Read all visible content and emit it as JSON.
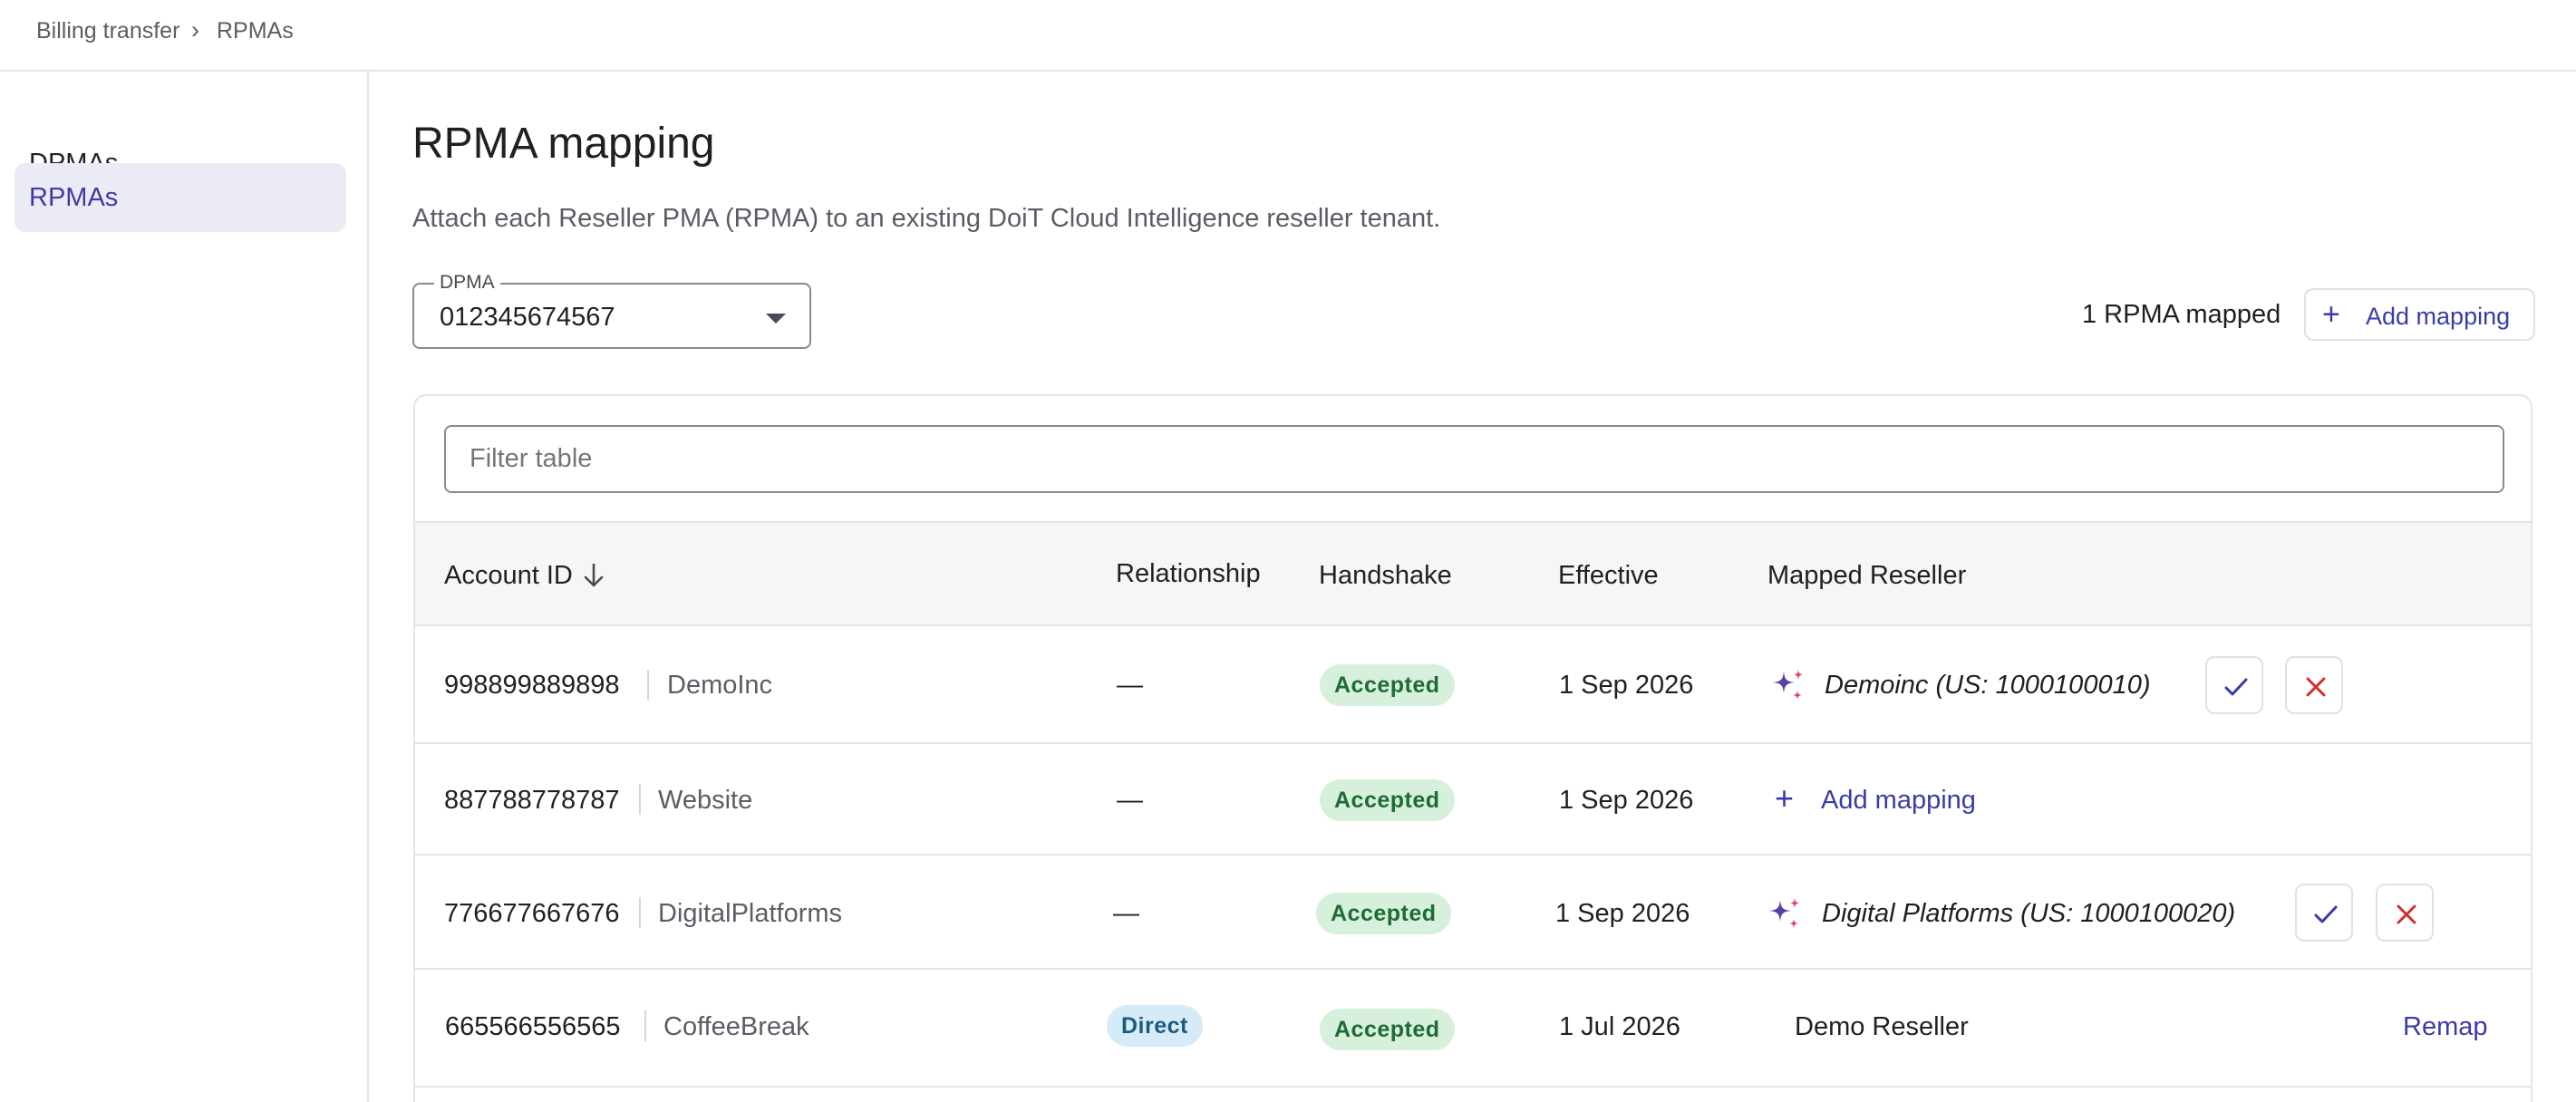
{
  "breadcrumb": {
    "parent": "Billing transfer",
    "separator": "›",
    "current": "RPMAs"
  },
  "sidebar": {
    "items": [
      {
        "label": "DPMAs"
      },
      {
        "label": "RPMAs"
      }
    ]
  },
  "main": {
    "title": "RPMA mapping",
    "subtitle": "Attach each Reseller PMA (RPMA) to an existing DoiT Cloud Intelligence reseller tenant.",
    "dpma_select": {
      "label": "DPMA",
      "value": "012345674567"
    },
    "mapped_count": "1 RPMA mapped",
    "add_mapping_label": "Add mapping"
  },
  "table": {
    "filter_placeholder": "Filter table",
    "columns": {
      "account_id": "Account ID",
      "relationship": "Relationship",
      "handshake": "Handshake",
      "effective": "Effective",
      "mapped_reseller": "Mapped Reseller"
    },
    "rows": [
      {
        "account_id": "998899889898",
        "name": "DemoInc",
        "relationship": "—",
        "handshake": "Accepted",
        "effective": "1 Sep 2026",
        "reseller": "Demoinc (US: 1000100010)"
      },
      {
        "account_id": "887788778787",
        "name": "Website",
        "relationship": "—",
        "handshake": "Accepted",
        "effective": "1 Sep 2026",
        "action_label": "Add mapping"
      },
      {
        "account_id": "776677667676",
        "name": "DigitalPlatforms",
        "relationship": "—",
        "handshake": "Accepted",
        "effective": "1 Sep 2026",
        "reseller": "Digital Platforms (US: 1000100020)"
      },
      {
        "account_id": "665566556565",
        "name": "CoffeeBreak",
        "relationship": "Direct",
        "handshake": "Accepted",
        "effective": "1 Jul 2026",
        "reseller_plain": "Demo Reseller",
        "action_label": "Remap"
      }
    ]
  },
  "colors": {
    "accent": "#3b3ba8",
    "accepted_bg": "#d6f0dc",
    "accepted_fg": "#1e6b35",
    "direct_bg": "#d6ebf8",
    "direct_fg": "#1d5a80",
    "danger": "#d32f2f"
  },
  "icons": [
    "chevron-right-icon",
    "caret-down-icon",
    "plus-icon",
    "arrow-down-icon",
    "sparkle-icon",
    "check-icon",
    "close-icon"
  ]
}
